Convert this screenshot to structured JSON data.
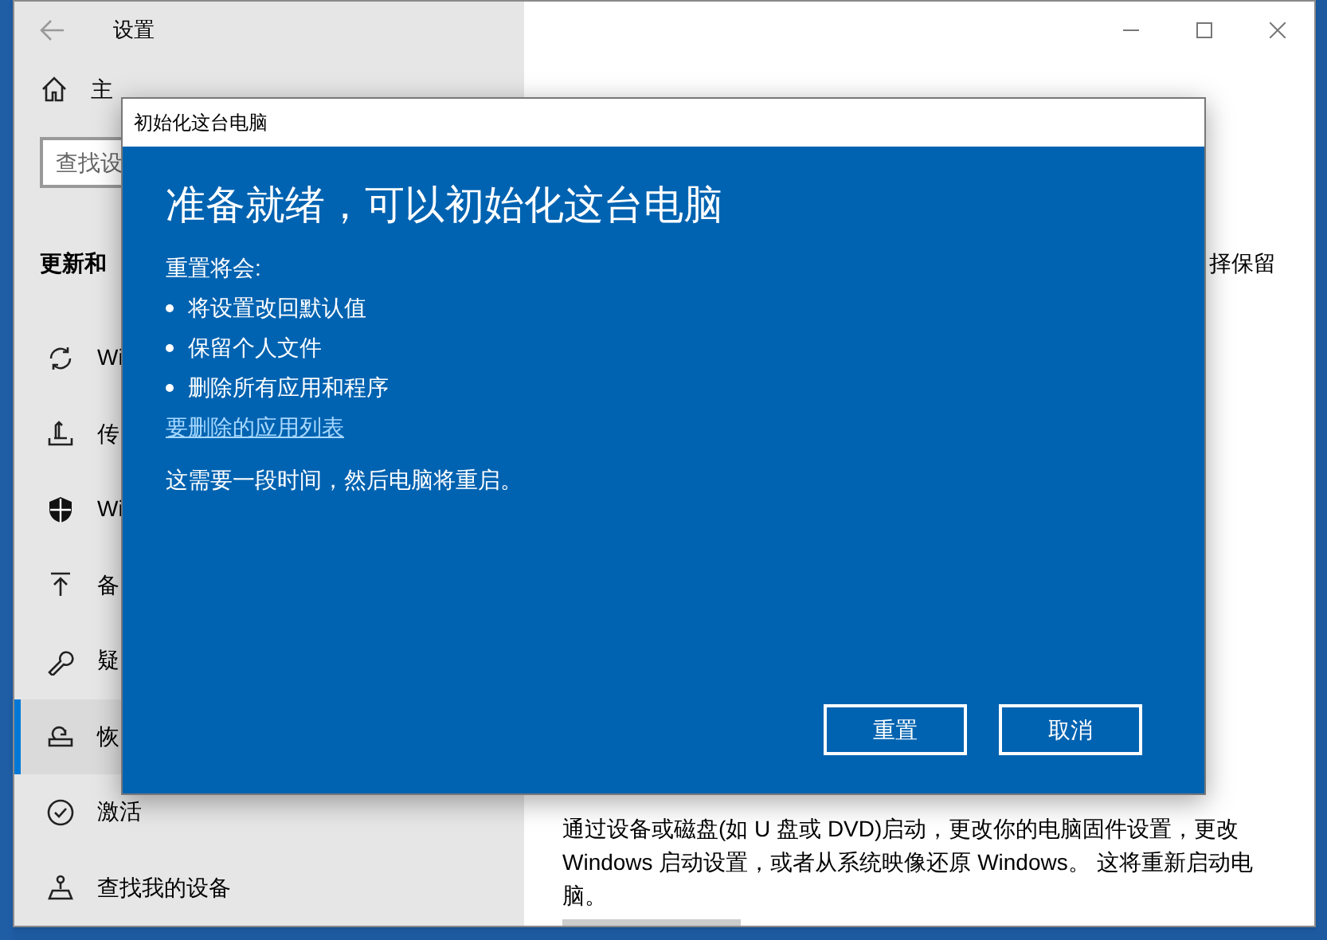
{
  "window": {
    "title": "设置"
  },
  "sidebar": {
    "home": "主",
    "search": {
      "placeholder": "查找设"
    },
    "section": "更新和",
    "items": [
      {
        "label": "Wi",
        "kind": "sync",
        "selected": false
      },
      {
        "label": "传",
        "kind": "delivery",
        "selected": false
      },
      {
        "label": "Wi",
        "kind": "shield",
        "selected": false
      },
      {
        "label": "备",
        "kind": "backup",
        "selected": false
      },
      {
        "label": "疑",
        "kind": "wrench",
        "selected": false
      },
      {
        "label": "恢",
        "kind": "recovery",
        "selected": true
      },
      {
        "label": "激活",
        "kind": "check",
        "selected": false
      },
      {
        "label": "查找我的设备",
        "kind": "find",
        "selected": false
      }
    ]
  },
  "content": {
    "partial_text": "择保留",
    "description": "通过设备或磁盘(如 U 盘或 DVD)启动，更改你的电脑固件设置，更改 Windows 启动设置，或者从系统映像还原 Windows。 这将重新启动电脑。"
  },
  "dialog": {
    "title": "初始化这台电脑",
    "heading": "准备就绪，可以初始化这台电脑",
    "intro": "重置将会:",
    "bullets": [
      "将设置改回默认值",
      "保留个人文件",
      "删除所有应用和程序"
    ],
    "link": "要删除的应用列表",
    "note": "这需要一段时间，然后电脑将重启。",
    "buttons": [
      "重置",
      "取消"
    ]
  }
}
